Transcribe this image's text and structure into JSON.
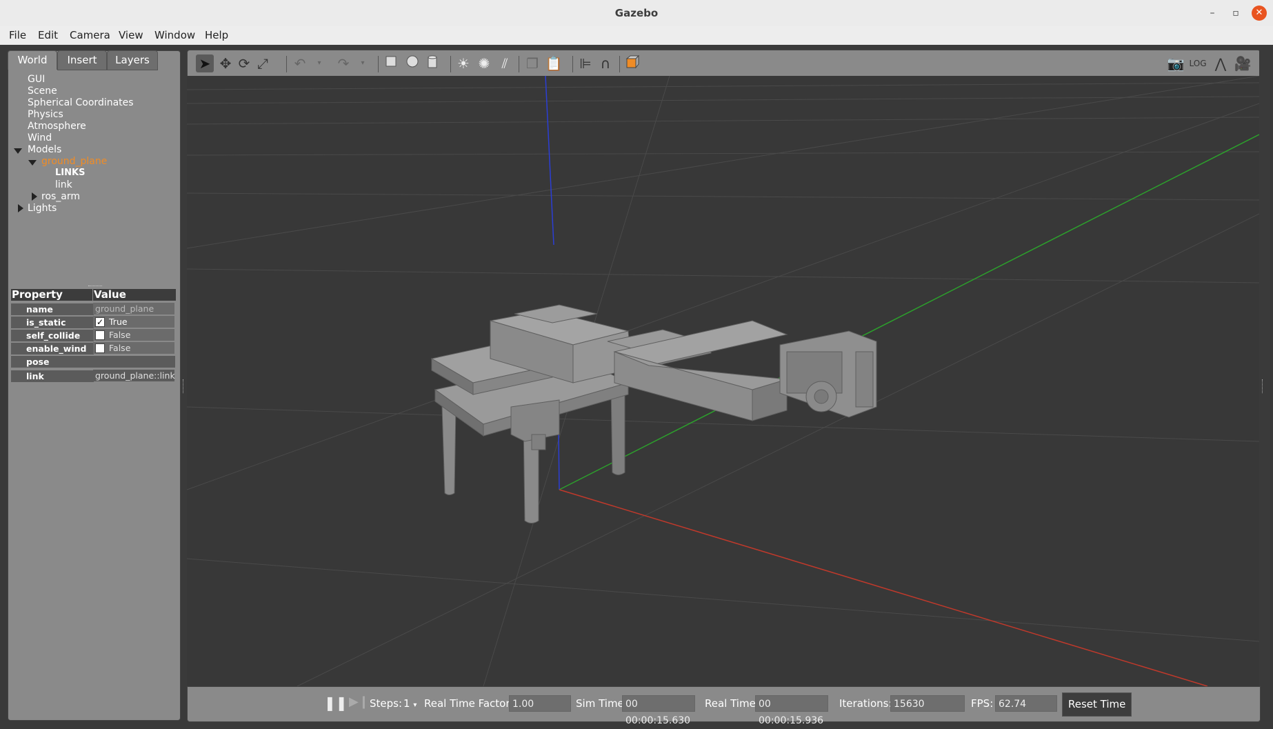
{
  "window": {
    "title": "Gazebo",
    "minimize": "–",
    "maximize": "▫",
    "close": "✕"
  },
  "menu": [
    "File",
    "Edit",
    "Camera",
    "View",
    "Window",
    "Help"
  ],
  "tabs": {
    "world": "World",
    "insert": "Insert",
    "layers": "Layers"
  },
  "tree": {
    "gui": "GUI",
    "scene": "Scene",
    "spherical": "Spherical Coordinates",
    "physics": "Physics",
    "atmosphere": "Atmosphere",
    "wind": "Wind",
    "models": "Models",
    "ground_plane": "ground_plane",
    "links_header": "LINKS",
    "link": "link",
    "ros_arm": "ros_arm",
    "lights": "Lights"
  },
  "properties": {
    "header_property": "Property",
    "header_value": "Value",
    "rows": [
      {
        "name": "name",
        "value": "ground_plane"
      },
      {
        "name": "is_static",
        "value": "True",
        "checked": true
      },
      {
        "name": "self_collide",
        "value": "False",
        "checked": false
      },
      {
        "name": "enable_wind",
        "value": "False",
        "checked": false
      },
      {
        "name": "pose",
        "value": ""
      },
      {
        "name": "link",
        "value": "ground_plane::link"
      }
    ]
  },
  "toolbar_icons": [
    "select-icon",
    "translate-icon",
    "rotate-icon",
    "scale-icon",
    "undo-icon",
    "redo-icon",
    "box-icon",
    "sphere-icon",
    "cylinder-icon",
    "pointlight-icon",
    "spotlight-icon",
    "directionallight-icon",
    "copy-icon",
    "paste-icon",
    "align-icon",
    "snap-icon",
    "view-angle-icon",
    "screenshot-icon",
    "log-icon",
    "plot-icon",
    "video-icon"
  ],
  "status": {
    "steps_label": "Steps:",
    "steps_value": "1",
    "rtf_label": "Real Time Factor:",
    "rtf_value": "1.00",
    "sim_label": "Sim Time:",
    "sim_value": "00 00:00:15.630",
    "real_label": "Real Time:",
    "real_value": "00 00:00:15.936",
    "iter_label": "Iterations:",
    "iter_value": "15630",
    "fps_label": "FPS:",
    "fps_value": "62.74",
    "reset": "Reset Time"
  },
  "colors": {
    "selected": "#f08c26",
    "x_axis": "#c0392b",
    "y_axis": "#2ca02c",
    "z_axis": "#2b3ed6",
    "model": "#8a8a8a"
  }
}
